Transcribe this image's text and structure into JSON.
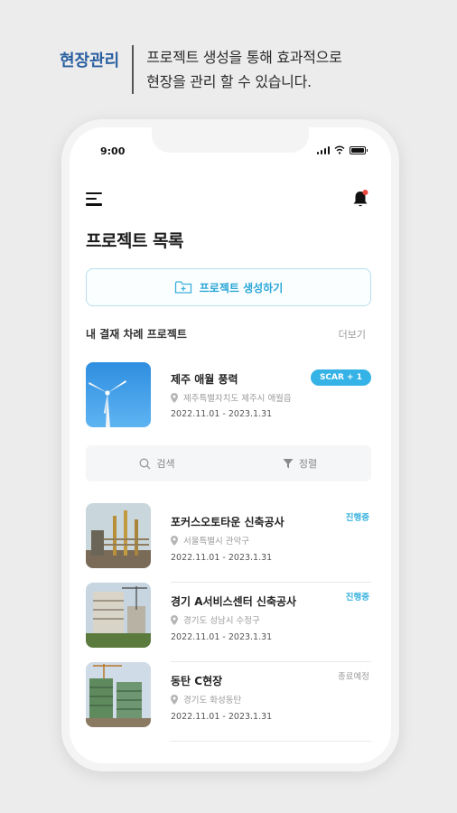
{
  "promo": {
    "title": "현장관리",
    "line1": "프로젝트 생성을 통해 효과적으로",
    "line2": "현장을 관리 할 수 있습니다."
  },
  "status_bar": {
    "time": "9:00"
  },
  "header": {
    "title": "프로젝트 목록",
    "create_button": "프로젝트 생성하기"
  },
  "section": {
    "label": "내 결재 차례 프로젝트",
    "more": "더보기"
  },
  "featured": {
    "title": "제주 애월 풍력",
    "location": "제주특별자치도 제주시 애월읍",
    "date": "2022.11.01 - 2023.1.31",
    "badge": "SCAR + 1"
  },
  "toolbar": {
    "search": "검색",
    "sort": "정렬"
  },
  "projects": [
    {
      "title": "포커스오토타운 신축공사",
      "location": "서울특별시 관악구",
      "date": "2022.11.01 - 2023.1.31",
      "status": "진행중"
    },
    {
      "title": "경기 A서비스센터 신축공사",
      "location": "경기도 성남시 수정구",
      "date": "2022.11.01 - 2023.1.31",
      "status": "진행중"
    },
    {
      "title": "동탄 C현장",
      "location": "경기도 화성동탄",
      "date": "2022.11.01 - 2023.1.31",
      "status": "종료예정"
    }
  ],
  "colors": {
    "accent": "#35b3e6",
    "brand": "#2a5fa0",
    "in_progress": "#3bb3df",
    "pending": "#9a9a9a"
  }
}
